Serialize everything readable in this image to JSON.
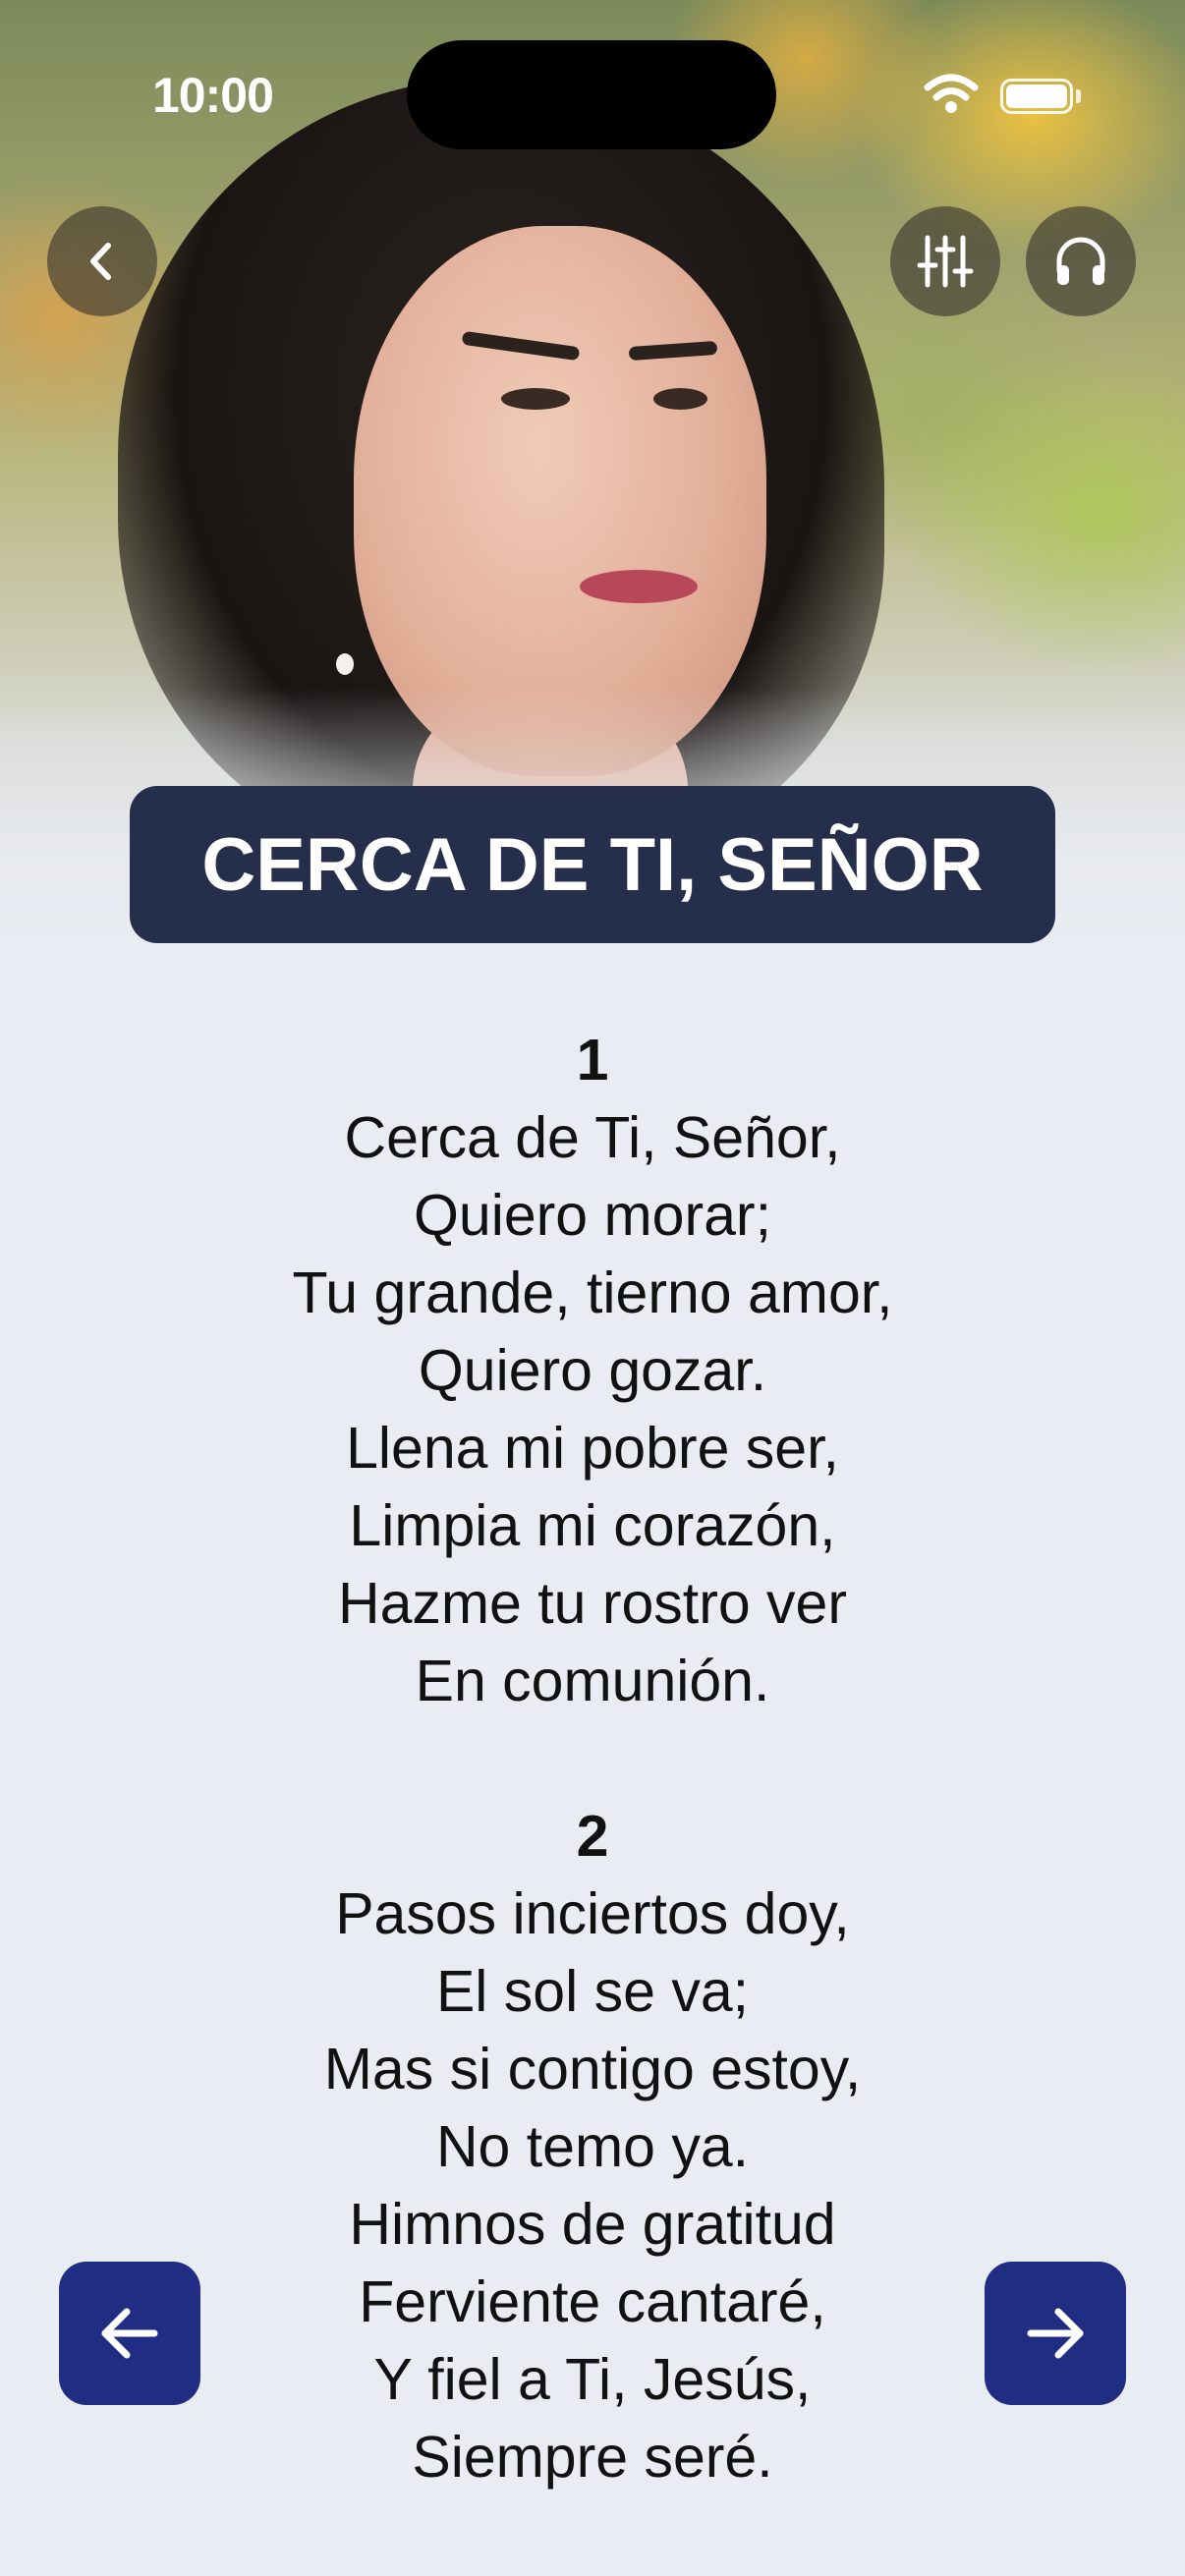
{
  "status_bar": {
    "time": "10:00"
  },
  "header": {
    "back_icon": "chevron-left-icon",
    "equalizer_icon": "sliders-icon",
    "audio_icon": "headphones-icon"
  },
  "song": {
    "title": "CERCA DE TI, SEÑOR",
    "verses": [
      {
        "number": "1",
        "lines": [
          "Cerca de Ti, Señor,",
          "Quiero morar;",
          "Tu grande, tierno amor,",
          "Quiero gozar.",
          "Llena mi pobre ser,",
          "Limpia mi corazón,",
          "Hazme tu rostro ver",
          "En comunión."
        ]
      },
      {
        "number": "2",
        "lines": [
          "Pasos inciertos doy,",
          "El sol se va;",
          "Mas si contigo estoy,",
          "No temo ya.",
          "Himnos de gratitud",
          "Ferviente cantaré,",
          "Y fiel a Ti, Jesús,",
          "Siempre seré."
        ]
      }
    ]
  },
  "navigation": {
    "prev_icon": "arrow-left-icon",
    "next_icon": "arrow-right-icon"
  },
  "colors": {
    "title_bg": "#252f4c",
    "nav_button_bg": "#1f2e83",
    "page_bg": "#e9ecf2"
  }
}
